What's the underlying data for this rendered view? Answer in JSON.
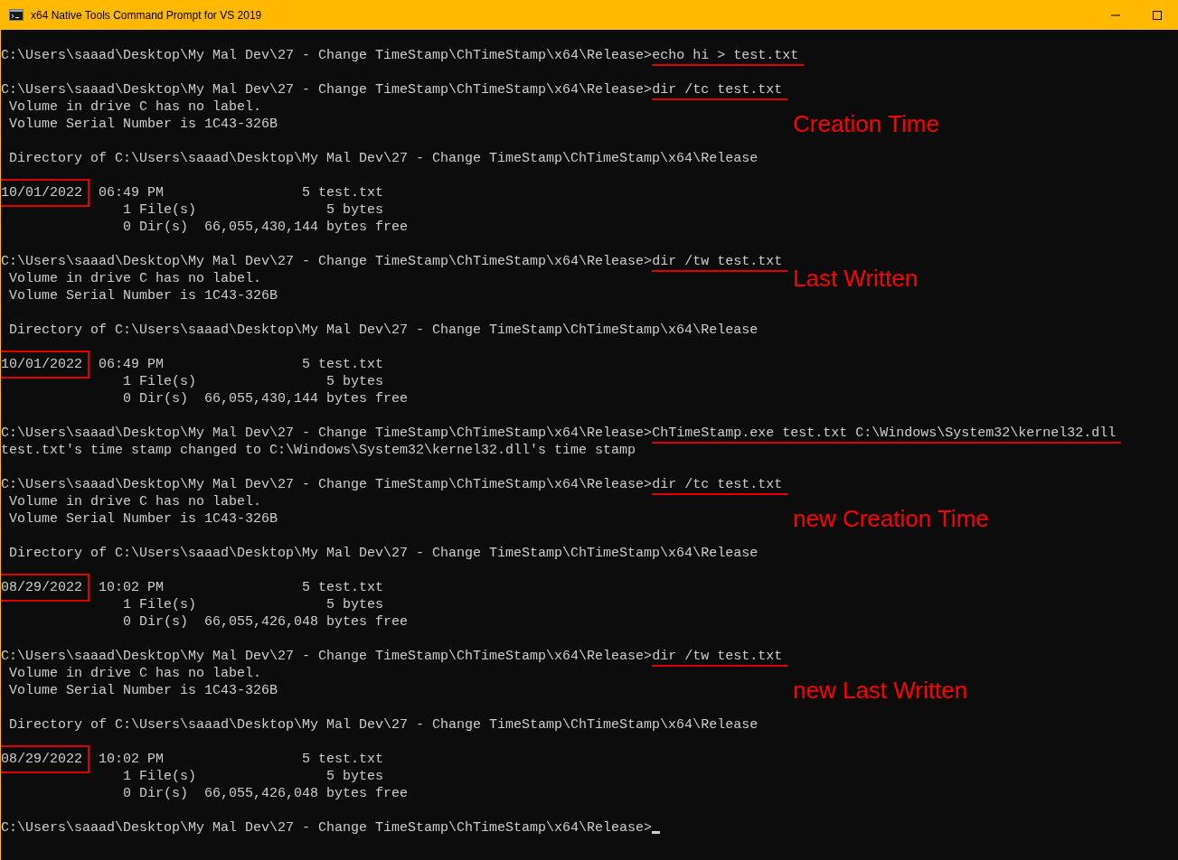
{
  "window": {
    "title": "x64 Native Tools Command Prompt for VS 2019"
  },
  "console": {
    "lines": [
      {
        "kind": "blank"
      },
      {
        "kind": "prompt",
        "path": "C:\\Users\\saaad\\Desktop\\My Mal Dev\\27 - Change TimeStamp\\ChTimeStamp\\x64\\Release>",
        "command": "echo hi > test.txt"
      },
      {
        "kind": "blank"
      },
      {
        "kind": "prompt",
        "path": "C:\\Users\\saaad\\Desktop\\My Mal Dev\\27 - Change TimeStamp\\ChTimeStamp\\x64\\Release>",
        "command": "dir /tc test.txt"
      },
      {
        "kind": "output",
        "text": " Volume in drive C has no label."
      },
      {
        "kind": "output",
        "text": " Volume Serial Number is 1C43-326B",
        "annotation": "Creation Time"
      },
      {
        "kind": "blank"
      },
      {
        "kind": "output",
        "text": " Directory of C:\\Users\\saaad\\Desktop\\My Mal Dev\\27 - Change TimeStamp\\ChTimeStamp\\x64\\Release"
      },
      {
        "kind": "blank"
      },
      {
        "kind": "date",
        "date": "10/01/2022",
        "text": "  06:49 PM                 5 test.txt"
      },
      {
        "kind": "output",
        "text": "               1 File(s)                5 bytes"
      },
      {
        "kind": "output",
        "text": "               0 Dir(s)  66,055,430,144 bytes free"
      },
      {
        "kind": "blank"
      },
      {
        "kind": "prompt",
        "path": "C:\\Users\\saaad\\Desktop\\My Mal Dev\\27 - Change TimeStamp\\ChTimeStamp\\x64\\Release>",
        "command": "dir /tw test.txt"
      },
      {
        "kind": "output",
        "text": " Volume in drive C has no label.",
        "annotation": "Last Written"
      },
      {
        "kind": "output",
        "text": " Volume Serial Number is 1C43-326B"
      },
      {
        "kind": "blank"
      },
      {
        "kind": "output",
        "text": " Directory of C:\\Users\\saaad\\Desktop\\My Mal Dev\\27 - Change TimeStamp\\ChTimeStamp\\x64\\Release"
      },
      {
        "kind": "blank"
      },
      {
        "kind": "date",
        "date": "10/01/2022",
        "text": "  06:49 PM                 5 test.txt"
      },
      {
        "kind": "output",
        "text": "               1 File(s)                5 bytes"
      },
      {
        "kind": "output",
        "text": "               0 Dir(s)  66,055,430,144 bytes free"
      },
      {
        "kind": "blank"
      },
      {
        "kind": "prompt",
        "path": "C:\\Users\\saaad\\Desktop\\My Mal Dev\\27 - Change TimeStamp\\ChTimeStamp\\x64\\Release>",
        "command": "ChTimeStamp.exe test.txt C:\\Windows\\System32\\kernel32.dll"
      },
      {
        "kind": "output",
        "text": "test.txt's time stamp changed to C:\\Windows\\System32\\kernel32.dll's time stamp"
      },
      {
        "kind": "blank"
      },
      {
        "kind": "prompt",
        "path": "C:\\Users\\saaad\\Desktop\\My Mal Dev\\27 - Change TimeStamp\\ChTimeStamp\\x64\\Release>",
        "command": "dir /tc test.txt"
      },
      {
        "kind": "output",
        "text": " Volume in drive C has no label."
      },
      {
        "kind": "output",
        "text": " Volume Serial Number is 1C43-326B",
        "annotation": "new Creation Time"
      },
      {
        "kind": "blank"
      },
      {
        "kind": "output",
        "text": " Directory of C:\\Users\\saaad\\Desktop\\My Mal Dev\\27 - Change TimeStamp\\ChTimeStamp\\x64\\Release"
      },
      {
        "kind": "blank"
      },
      {
        "kind": "date",
        "date": "08/29/2022",
        "text": "  10:02 PM                 5 test.txt"
      },
      {
        "kind": "output",
        "text": "               1 File(s)                5 bytes"
      },
      {
        "kind": "output",
        "text": "               0 Dir(s)  66,055,426,048 bytes free"
      },
      {
        "kind": "blank"
      },
      {
        "kind": "prompt",
        "path": "C:\\Users\\saaad\\Desktop\\My Mal Dev\\27 - Change TimeStamp\\ChTimeStamp\\x64\\Release>",
        "command": "dir /tw test.txt"
      },
      {
        "kind": "output",
        "text": " Volume in drive C has no label."
      },
      {
        "kind": "output",
        "text": " Volume Serial Number is 1C43-326B",
        "annotation": "new Last Written"
      },
      {
        "kind": "blank"
      },
      {
        "kind": "output",
        "text": " Directory of C:\\Users\\saaad\\Desktop\\My Mal Dev\\27 - Change TimeStamp\\ChTimeStamp\\x64\\Release"
      },
      {
        "kind": "blank"
      },
      {
        "kind": "date",
        "date": "08/29/2022",
        "text": "  10:02 PM                 5 test.txt"
      },
      {
        "kind": "output",
        "text": "               1 File(s)                5 bytes"
      },
      {
        "kind": "output",
        "text": "               0 Dir(s)  66,055,426,048 bytes free"
      },
      {
        "kind": "blank"
      },
      {
        "kind": "prompt",
        "path": "C:\\Users\\saaad\\Desktop\\My Mal Dev\\27 - Change TimeStamp\\ChTimeStamp\\x64\\Release>",
        "cursor": true
      }
    ]
  }
}
